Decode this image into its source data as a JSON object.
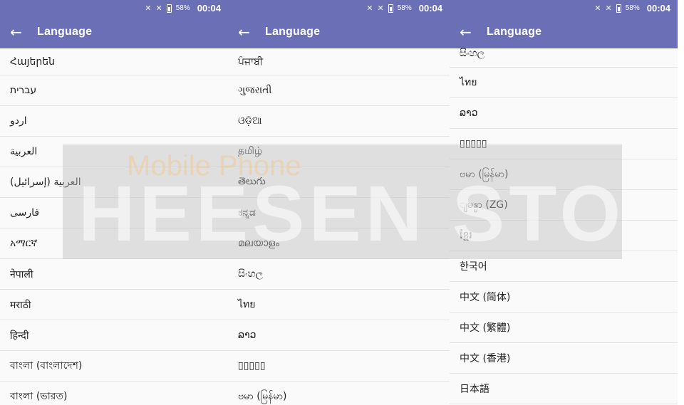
{
  "status": {
    "battery": "58%",
    "time": "00:04"
  },
  "app": {
    "title": "Language"
  },
  "panels": [
    {
      "items": [
        "Հայերեն",
        "עברית",
        "اردو",
        "العربية",
        "العربية (إسرائيل)",
        "فارسی",
        "አማርኛ",
        "नेपाली",
        "मराठी",
        "हिन्दी",
        "বাংলা (বাংলাদেশ)",
        "বাংলা (ভারত)"
      ]
    },
    {
      "items": [
        "ਪੰਜਾਬੀ",
        "ગુજરાતી",
        "ଓଡ଼ିଆ",
        "தமிழ்",
        "తెలుగు",
        "ಕನ್ನಡ",
        "മലയാളം",
        "සිංහල",
        "ไทย",
        "ລາວ",
        "▯▯▯▯▯",
        "ဗမာ (မြန်မာ)"
      ]
    },
    {
      "items": [
        "සිංහල",
        "ไทย",
        "ລາວ",
        "▯▯▯▯▯",
        "ဗမာ (မြန်မာ)",
        "ျမန္မာ (ZG)",
        "ខ្មែរ",
        "한국어",
        "中文 (简体)",
        "中文 (繁體)",
        "中文 (香港)",
        "日本語"
      ]
    }
  ],
  "watermark": {
    "top": "Mobile Phone",
    "main": "HEESEN STORE"
  }
}
